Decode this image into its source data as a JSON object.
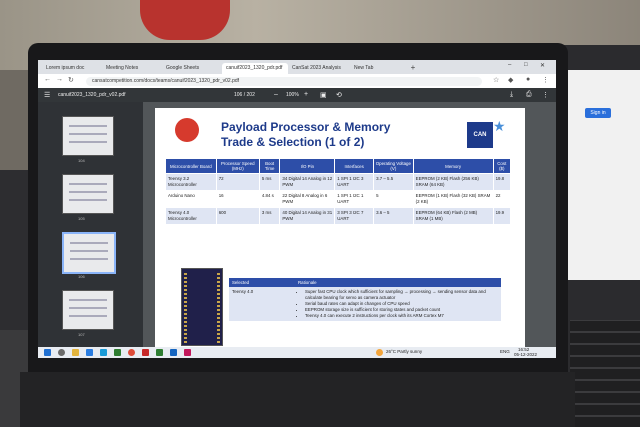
{
  "browser": {
    "tabs": [
      {
        "label": "Lorem ipsum doc"
      },
      {
        "label": "Meeting Notes"
      },
      {
        "label": "Google Sheets"
      },
      {
        "label": "canuif2023_1320_pdr.pdf"
      },
      {
        "label": "CanSat 2023 Analysis"
      },
      {
        "label": "New Tab"
      }
    ],
    "url": "cansatcompetition.com/docs/teams/canuif2023_1320_pdr_v02.pdf"
  },
  "pdf_toolbar": {
    "file_name": "canuif2023_1320_pdr_v02.pdf",
    "page_indicator": "106 / 202",
    "zoom": "100%"
  },
  "sidebar": {
    "thumbs": [
      {
        "num": "104"
      },
      {
        "num": "105"
      },
      {
        "num": "106"
      },
      {
        "num": "107"
      }
    ]
  },
  "slide": {
    "title_line1": "Payload Processor & Memory",
    "title_line2": "Trade & Selection (1 of 2)",
    "badge": "CAN SAT",
    "table": {
      "headers": [
        "Microcontroller Board",
        "Processor Speed (MHz)",
        "Boot Time",
        "I/O Pin",
        "Interfaces",
        "Operating Voltage (V)",
        "Memory",
        "Cost ($)"
      ],
      "rows": [
        {
          "board": "Teensy 3.2 Microcontroller",
          "speed": "72",
          "boot": "5 ms",
          "io": "34 Digital 14 Analog in 12 PWM",
          "interfaces": "1 SPI 1 I2C 3 UART",
          "voltage": "3.7 – 5.5",
          "memory": "EEPROM (2 KB) Flash (256 KB) SRAM (64 KB)",
          "cost": "19.8"
        },
        {
          "board": "Arduino Nano",
          "speed": "16",
          "boot": "4.84 s",
          "io": "22 Digital 8 Analog in 6 PWM",
          "interfaces": "1 SPI 1 I2C 1 UART",
          "voltage": "5",
          "memory": "EEPROM (1 KB) Flash (32 KB) SRAM (2 KB)",
          "cost": "22"
        },
        {
          "board": "Teensy 4.0 Microcontroller",
          "speed": "600",
          "boot": "3 ms",
          "io": "40 Digital 14 Analog in 31 PWM",
          "interfaces": "3 SPI 3 I2C 7 UART",
          "voltage": "3.6 – 5",
          "memory": "EEPROM (64 KB) Flash (2 MB) SRAM (1 MB)",
          "cost": "19.9"
        }
      ]
    },
    "selection": {
      "header_selected": "Selected",
      "header_rationale": "Rationale",
      "selected": "Teensy 4.0",
      "rationale": [
        "Super fast CPU clock which sufficient for sampling → processing → sending sensor data and calculate bearing for servo as camera actuator",
        "Serial baud rates can adapt in changes of CPU speed",
        "EEPROM storage size is sufficient for storing states and packet count",
        "Teensy 4.0 can execute 2 instructions per clock with its ARM Cortex M7"
      ]
    }
  },
  "taskbar": {
    "weather": "26°C Partly sunny",
    "lang": "ENG",
    "time": "16:52",
    "date": "05-12-2022"
  },
  "right_laptop": {
    "signin": "Sign in"
  }
}
